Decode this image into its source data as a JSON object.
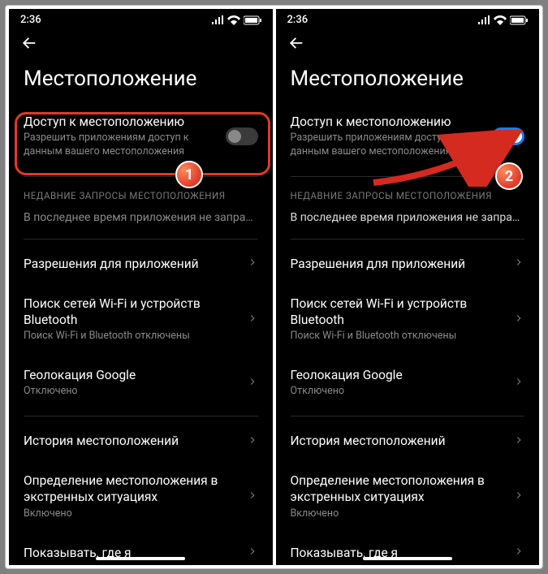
{
  "status": {
    "time": "2:36"
  },
  "header": {
    "title": "Местоположение"
  },
  "location_access": {
    "title": "Доступ к местоположению",
    "subtitle": "Разрешить приложениям доступ к данным вашего местоположения"
  },
  "recent": {
    "label": "НЕДАВНИЕ ЗАПРОСЫ МЕСТОПОЛОЖЕНИЯ",
    "empty_off": "В последнее время приложения не запраш..",
    "empty_on": "В последнее время приложения не запраш.."
  },
  "rows": {
    "permissions": {
      "title": "Разрешения для приложений"
    },
    "wifi_bt": {
      "title": "Поиск сетей Wi-Fi и устройств Bluetooth",
      "subtitle": "Поиск Wi-Fi и Bluetooth отключены"
    },
    "google_loc": {
      "title": "Геолокация Google",
      "subtitle": "Отключено"
    },
    "history": {
      "title": "История местоположений"
    },
    "emergency": {
      "title": "Определение местоположения в экстренных ситуациях",
      "subtitle": "Включено"
    },
    "show_where": {
      "title": "Показывать, где я"
    }
  },
  "badges": {
    "one": "1",
    "two": "2"
  }
}
